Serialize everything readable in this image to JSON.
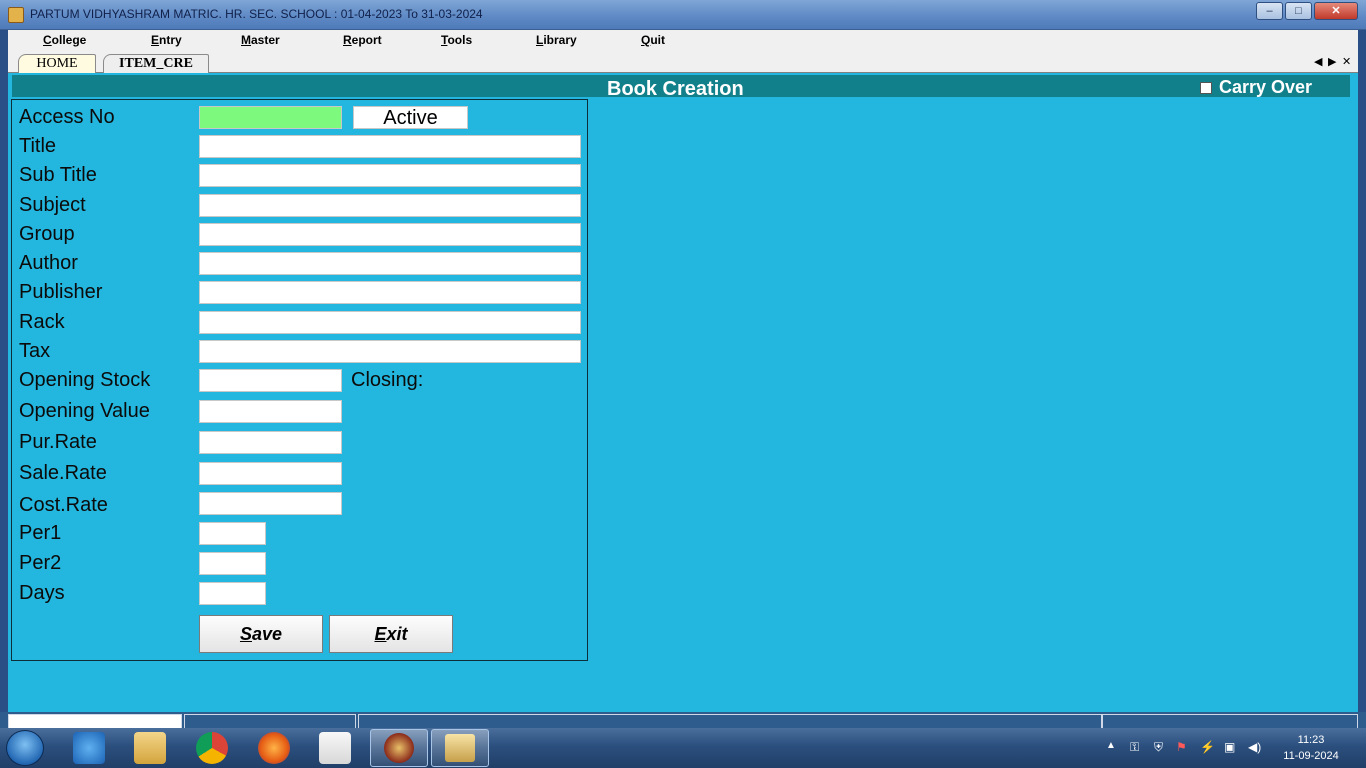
{
  "window": {
    "title": "PARTUM VIDHYASHRAM MATRIC. HR. SEC. SCHOOL  :  01-04-2023 To 31-03-2024",
    "minimize_glyph": "–",
    "maximize_glyph": "□",
    "close_glyph": "✕"
  },
  "menu": {
    "college": "College",
    "entry": "Entry",
    "master": "Master",
    "report": "Report",
    "tools": "Tools",
    "library": "Library",
    "quit": "Quit"
  },
  "tabs": {
    "home": "HOME",
    "item": "ITEM_CRE",
    "nav_prev": "◀",
    "nav_next": "▶",
    "nav_close": "✕"
  },
  "header": {
    "title": "Book Creation",
    "carry_over_label": "Carry Over",
    "carry_over_checked": false
  },
  "form": {
    "access_no_label": "Access No",
    "status_value": "Active",
    "title_label": "Title",
    "subtitle_label": "Sub Title",
    "subject_label": "Subject",
    "group_label": "Group",
    "author_label": "Author",
    "publisher_label": "Publisher",
    "rack_label": "Rack",
    "tax_label": "Tax",
    "opening_stock_label": "Opening Stock",
    "closing_label": "Closing:",
    "opening_value_label": "Opening Value",
    "pur_rate_label": "Pur.Rate",
    "sale_rate_label": "Sale.Rate",
    "cost_rate_label": "Cost.Rate",
    "per1_label": "Per1",
    "per2_label": "Per2",
    "days_label": "Days",
    "save_label": "Save",
    "exit_label": "Exit"
  },
  "taskbar": {
    "time": "11:23",
    "date": "11-09-2024"
  },
  "colors": {
    "form_background": "#23b6de",
    "header_bar": "#11808a",
    "access_field": "#7dfa7d"
  }
}
